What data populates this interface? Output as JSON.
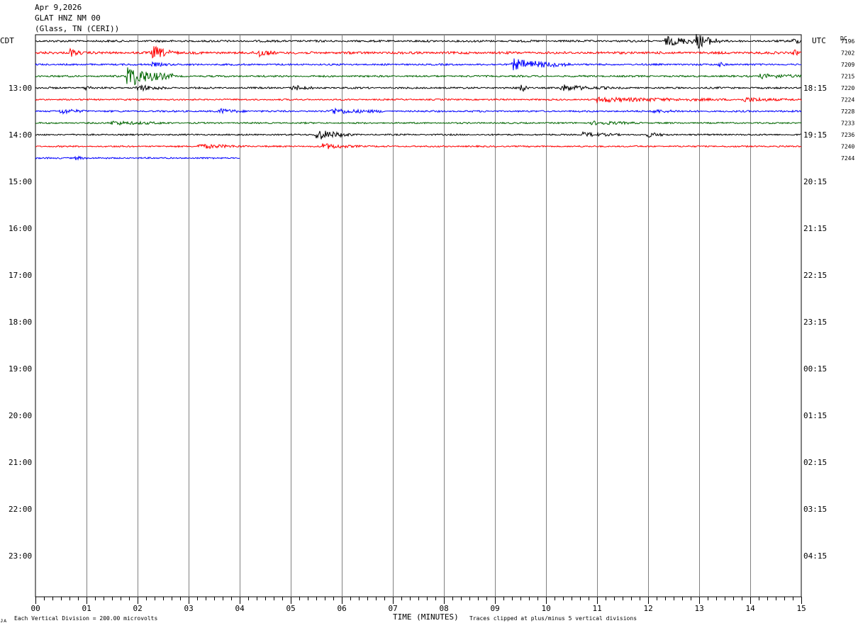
{
  "header": {
    "date": "Apr 9,2026",
    "station": "GLAT HNZ NM 00",
    "location": "(Glass, TN (CERI))"
  },
  "left_zone": "CDT",
  "right_zone": "UTC",
  "right_count_header": "DC",
  "footer": {
    "vertical_division": "Each Vertical Division =  200.00 microvolts",
    "clip_note": "Traces clipped at plus/minus 5 vertical divisions",
    "corner_mark": "ᴊᴀ"
  },
  "colors": {
    "trace_cycle": [
      "#000000",
      "#ff0000",
      "#0000ff",
      "#006600"
    ],
    "grid": "#808080"
  },
  "chart_data": {
    "type": "line",
    "title": "",
    "xlabel": "TIME (MINUTES)",
    "xlim": [
      0,
      15
    ],
    "x_ticks": [
      "00",
      "01",
      "02",
      "03",
      "04",
      "05",
      "06",
      "07",
      "08",
      "09",
      "10",
      "11",
      "12",
      "13",
      "14",
      "15"
    ],
    "left_hour_labels": [
      "13:00",
      "14:00",
      "15:00",
      "16:00",
      "17:00",
      "18:00",
      "19:00",
      "20:00",
      "21:00",
      "22:00",
      "23:00"
    ],
    "right_hour_labels": [
      "18:15",
      "19:15",
      "20:15",
      "21:15",
      "22:15",
      "23:15",
      "00:15",
      "01:15",
      "02:15",
      "03:15",
      "04:15"
    ],
    "traces": [
      {
        "count": "7196",
        "end_minute": 15,
        "noise": 0.9,
        "drift": 0,
        "events": [
          {
            "t": 12.35,
            "amp": 6,
            "dur": 0.5
          },
          {
            "t": 12.95,
            "amp": 9,
            "dur": 0.25
          },
          {
            "t": 14.85,
            "amp": 4,
            "dur": 0.1
          }
        ]
      },
      {
        "count": "7202",
        "end_minute": 15,
        "noise": 1.1,
        "drift": 0,
        "events": [
          {
            "t": 0.68,
            "amp": 6,
            "dur": 0.12
          },
          {
            "t": 2.3,
            "amp": 9,
            "dur": 0.25
          },
          {
            "t": 4.35,
            "amp": 6,
            "dur": 0.2
          },
          {
            "t": 14.85,
            "amp": 4,
            "dur": 0.1
          }
        ]
      },
      {
        "count": "7209",
        "end_minute": 15,
        "noise": 0.8,
        "drift": 0,
        "events": [
          {
            "t": 2.3,
            "amp": 3,
            "dur": 0.2
          },
          {
            "t": 9.35,
            "amp": 8,
            "dur": 0.6
          },
          {
            "t": 13.4,
            "amp": 3,
            "dur": 0.1
          }
        ]
      },
      {
        "count": "7215",
        "end_minute": 15,
        "noise": 0.8,
        "drift": 0,
        "events": [
          {
            "t": 1.8,
            "amp": 16,
            "dur": 0.45
          },
          {
            "t": 14.2,
            "amp": 3,
            "dur": 0.5
          }
        ]
      },
      {
        "count": "7220",
        "end_minute": 15,
        "noise": 0.8,
        "drift": 0,
        "events": [
          {
            "t": 0.98,
            "amp": 3,
            "dur": 0.1
          },
          {
            "t": 2.0,
            "amp": 4,
            "dur": 0.3
          },
          {
            "t": 5.05,
            "amp": 4,
            "dur": 0.2
          },
          {
            "t": 9.5,
            "amp": 10,
            "dur": 0.08
          },
          {
            "t": 10.3,
            "amp": 4,
            "dur": 0.5
          }
        ]
      },
      {
        "count": "7224",
        "end_minute": 15,
        "noise": 0.7,
        "drift": 0,
        "events": [
          {
            "t": 11.0,
            "amp": 3,
            "dur": 1.5
          },
          {
            "t": 13.9,
            "amp": 2.5,
            "dur": 0.6
          }
        ]
      },
      {
        "count": "7228",
        "end_minute": 15,
        "noise": 0.8,
        "drift": 0,
        "events": [
          {
            "t": 0.5,
            "amp": 3,
            "dur": 0.3
          },
          {
            "t": 3.6,
            "amp": 3,
            "dur": 0.3
          },
          {
            "t": 5.8,
            "amp": 4,
            "dur": 0.5
          },
          {
            "t": 12.1,
            "amp": 2.5,
            "dur": 0.3
          }
        ]
      },
      {
        "count": "7233",
        "end_minute": 15,
        "noise": 0.7,
        "drift": 0,
        "events": [
          {
            "t": 1.5,
            "amp": 2.5,
            "dur": 0.6
          },
          {
            "t": 10.9,
            "amp": 2.5,
            "dur": 0.5
          }
        ]
      },
      {
        "count": "7236",
        "end_minute": 15,
        "noise": 0.7,
        "drift": 0,
        "events": [
          {
            "t": 5.5,
            "amp": 8,
            "dur": 0.35
          },
          {
            "t": 10.7,
            "amp": 3,
            "dur": 0.4
          },
          {
            "t": 12.0,
            "amp": 3,
            "dur": 0.2
          }
        ]
      },
      {
        "count": "7240",
        "end_minute": 15,
        "noise": 0.7,
        "drift": 0,
        "events": [
          {
            "t": 3.2,
            "amp": 3,
            "dur": 0.5
          },
          {
            "t": 5.6,
            "amp": 4,
            "dur": 0.4
          }
        ]
      },
      {
        "count": "7244",
        "end_minute": 4.0,
        "noise": 0.7,
        "drift": 0,
        "events": [
          {
            "t": 0.8,
            "amp": 3,
            "dur": 0.1
          }
        ]
      }
    ]
  }
}
